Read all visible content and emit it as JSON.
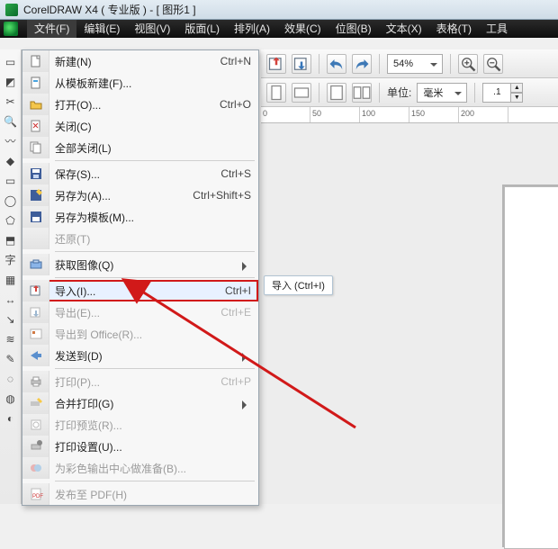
{
  "title": "CorelDRAW X4 ( 专业版 ) - [ 图形1 ]",
  "menubar": {
    "items": [
      {
        "label": "文件(F)",
        "open": true
      },
      {
        "label": "编辑(E)"
      },
      {
        "label": "视图(V)"
      },
      {
        "label": "版面(L)"
      },
      {
        "label": "排列(A)"
      },
      {
        "label": "效果(C)"
      },
      {
        "label": "位图(B)"
      },
      {
        "label": "文本(X)"
      },
      {
        "label": "表格(T)"
      },
      {
        "label": "工具"
      }
    ]
  },
  "toolbar1": {
    "zoom": "54%"
  },
  "toolbar2": {
    "unit_label": "单位:",
    "unit_value": "毫米",
    "spinner": ".1"
  },
  "ruler": {
    "ticks": [
      "0",
      "50",
      "100",
      "150",
      "200"
    ]
  },
  "file_menu": [
    {
      "kind": "item",
      "icon": "new-doc-icon",
      "label": "新建(N)",
      "shortcut": "Ctrl+N"
    },
    {
      "kind": "item",
      "icon": "new-template-icon",
      "label": "从模板新建(F)..."
    },
    {
      "kind": "item",
      "icon": "open-folder-icon",
      "label": "打开(O)...",
      "shortcut": "Ctrl+O"
    },
    {
      "kind": "item",
      "icon": "close-doc-icon",
      "label": "关闭(C)"
    },
    {
      "kind": "item",
      "icon": "close-all-icon",
      "label": "全部关闭(L)"
    },
    {
      "kind": "sep"
    },
    {
      "kind": "item",
      "icon": "save-icon",
      "label": "保存(S)...",
      "shortcut": "Ctrl+S"
    },
    {
      "kind": "item",
      "icon": "save-as-icon",
      "label": "另存为(A)...",
      "shortcut": "Ctrl+Shift+S"
    },
    {
      "kind": "item",
      "icon": "save-template-icon",
      "label": "另存为模板(M)..."
    },
    {
      "kind": "item",
      "icon": "",
      "label": "还原(T)",
      "disabled": true
    },
    {
      "kind": "sep"
    },
    {
      "kind": "item",
      "icon": "acquire-icon",
      "label": "获取图像(Q)",
      "submenu": true
    },
    {
      "kind": "sep"
    },
    {
      "kind": "item",
      "icon": "import-icon",
      "label": "导入(I)...",
      "shortcut": "Ctrl+I",
      "highlighted": true
    },
    {
      "kind": "item",
      "icon": "export-icon",
      "label": "导出(E)...",
      "shortcut": "Ctrl+E",
      "disabled": true
    },
    {
      "kind": "item",
      "icon": "export-office-icon",
      "label": "导出到 Office(R)...",
      "disabled": true
    },
    {
      "kind": "item",
      "icon": "send-to-icon",
      "label": "发送到(D)",
      "submenu": true
    },
    {
      "kind": "sep"
    },
    {
      "kind": "item",
      "icon": "print-icon",
      "label": "打印(P)...",
      "shortcut": "Ctrl+P",
      "disabled": true
    },
    {
      "kind": "item",
      "icon": "print-merge-icon",
      "label": "合并打印(G)",
      "submenu": true
    },
    {
      "kind": "item",
      "icon": "print-preview-icon",
      "label": "打印预览(R)...",
      "disabled": true
    },
    {
      "kind": "item",
      "icon": "print-setup-icon",
      "label": "打印设置(U)..."
    },
    {
      "kind": "item",
      "icon": "color-proof-icon",
      "label": "为彩色输出中心做准备(B)...",
      "disabled": true
    },
    {
      "kind": "sep"
    },
    {
      "kind": "item",
      "icon": "publish-pdf-icon",
      "label": "发布至 PDF(H)",
      "disabled": true
    }
  ],
  "tooltip": "导入 (Ctrl+I)",
  "palette_tools": [
    "pick-tool-icon",
    "shape-tool-icon",
    "crop-tool-icon",
    "zoom-tool-icon",
    "freehand-tool-icon",
    "smart-fill-icon",
    "rectangle-tool-icon",
    "ellipse-tool-icon",
    "polygon-tool-icon",
    "basic-shapes-icon",
    "text-tool-icon",
    "table-tool-icon",
    "dimension-tool-icon",
    "connector-tool-icon",
    "interactive-blend-icon",
    "eyedropper-tool-icon",
    "outline-tool-icon",
    "fill-tool-icon",
    "interactive-fill-icon"
  ]
}
